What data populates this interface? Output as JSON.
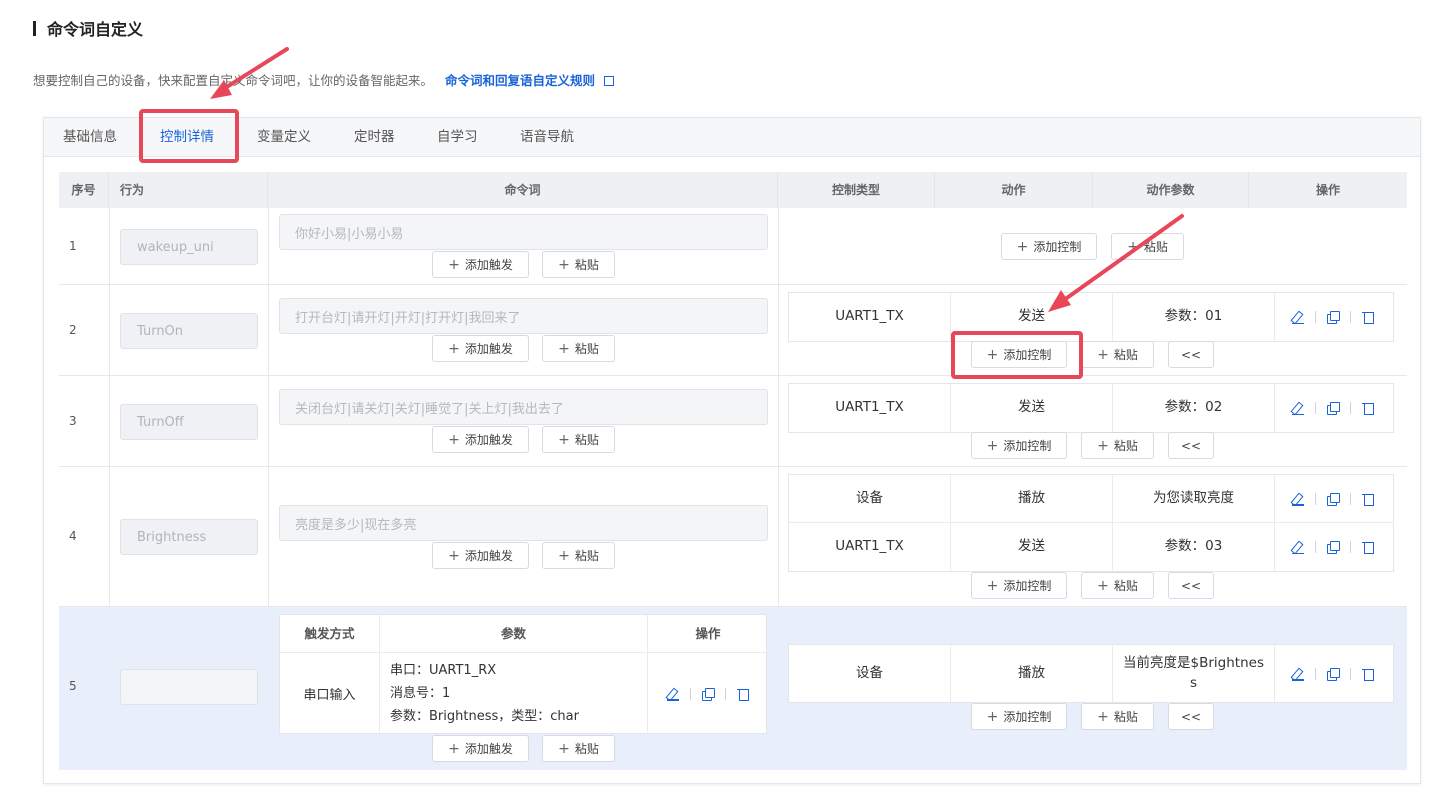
{
  "header": {
    "title": "命令词自定义"
  },
  "intro": {
    "text": "想要控制自己的设备，快来配置自定义命令词吧，让你的设备智能起来。",
    "link": "命令词和回复语自定义规则"
  },
  "tabs": [
    "基础信息",
    "控制详情",
    "变量定义",
    "定时器",
    "自学习",
    "语音导航"
  ],
  "table": {
    "headers": [
      "序号",
      "行为",
      "命令词",
      "控制类型",
      "动作",
      "动作参数",
      "操作"
    ],
    "rows": [
      {
        "index": "1",
        "behavior": "wakeup_uni",
        "command": "你好小易|小易小易",
        "controls": []
      },
      {
        "index": "2",
        "behavior": "TurnOn",
        "command": "打开台灯|请开灯|开灯|打开灯|我回来了",
        "controls": [
          {
            "type": "UART1_TX",
            "action": "发送",
            "param": "参数：01"
          }
        ]
      },
      {
        "index": "3",
        "behavior": "TurnOff",
        "command": "关闭台灯|请关灯|关灯|睡觉了|关上灯|我出去了",
        "controls": [
          {
            "type": "UART1_TX",
            "action": "发送",
            "param": "参数：02"
          }
        ]
      },
      {
        "index": "4",
        "behavior": "Brightness",
        "command": "亮度是多少|现在多亮",
        "controls": [
          {
            "type": "设备",
            "action": "播放",
            "param": "为您读取亮度"
          },
          {
            "type": "UART1_TX",
            "action": "发送",
            "param": "参数：03"
          }
        ]
      },
      {
        "index": "5",
        "behavior": "",
        "trigger": {
          "headers": [
            "触发方式",
            "参数",
            "操作"
          ],
          "mode": "串口输入",
          "params": [
            "串口：UART1_RX",
            "消息号：1",
            "参数：Brightness，类型：char"
          ]
        },
        "controls": [
          {
            "type": "设备",
            "action": "播放",
            "param": "当前亮度是$Brightness"
          }
        ]
      }
    ]
  },
  "buttons": {
    "add_trigger": "添加触发",
    "paste": "粘贴",
    "add_control": "添加控制",
    "collapse": "<<"
  },
  "icons": [
    "edit-icon",
    "copy-icon",
    "delete-icon",
    "external-link-icon",
    "plus-icon"
  ],
  "colors": {
    "accent": "#1a64d8",
    "annotation": "#e8475a",
    "highlight_row": "#e9eefb"
  }
}
